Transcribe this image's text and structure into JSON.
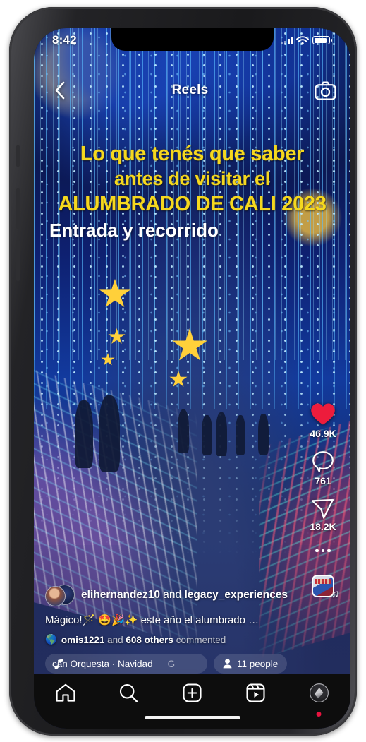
{
  "status_bar": {
    "time": "8:42",
    "icons": [
      "signal-bars-icon",
      "wifi-icon",
      "battery-icon"
    ]
  },
  "header": {
    "back_icon": "chevron-left-icon",
    "title": "Reels",
    "camera_icon": "camera-icon"
  },
  "video_overlay": {
    "line1": "Lo que tenés que saber",
    "line2": "antes de visitar el",
    "line3": "ALUMBRADO DE CALI 2023",
    "line4": "Entrada y recorrido",
    "highlight_color": "#f5d81f",
    "subtitle_color": "#ffffff"
  },
  "action_rail": {
    "like": {
      "icon": "heart-icon",
      "count": "46.9K",
      "liked": true,
      "color": "#ed1c3c"
    },
    "comment": {
      "icon": "comment-bubble-icon",
      "count": "761"
    },
    "share": {
      "icon": "paper-plane-icon",
      "count": "18.2K"
    },
    "more": {
      "icon": "ellipsis-icon"
    },
    "audio": {
      "icon": "audio-thumbnail-icon",
      "note_glyph": "♫"
    }
  },
  "post": {
    "author_primary": "elihernandez10",
    "collab_conjunction": " and ",
    "author_secondary": "legacy_experiences",
    "caption": "Mágico!🪄 🤩🎉✨ este año el alumbrado …",
    "comment_summary": {
      "globe_icon": "globe-icon",
      "user": "omis1221",
      "middle": " and ",
      "count": "608 others",
      "suffix": " commented"
    },
    "music_pill": {
      "icon": "music-note-icon",
      "track": "cán Orquesta · Navidad",
      "track_tail": "G"
    },
    "people_pill": {
      "icon": "person-icon",
      "label": "11 people"
    }
  },
  "tab_bar": {
    "items": [
      {
        "name": "home",
        "icon": "home-icon"
      },
      {
        "name": "search",
        "icon": "search-icon"
      },
      {
        "name": "create",
        "icon": "plus-square-icon"
      },
      {
        "name": "reels",
        "icon": "reels-icon"
      },
      {
        "name": "profile",
        "icon": "avatar-icon"
      }
    ],
    "profile_badge_color": "#e8133f"
  }
}
